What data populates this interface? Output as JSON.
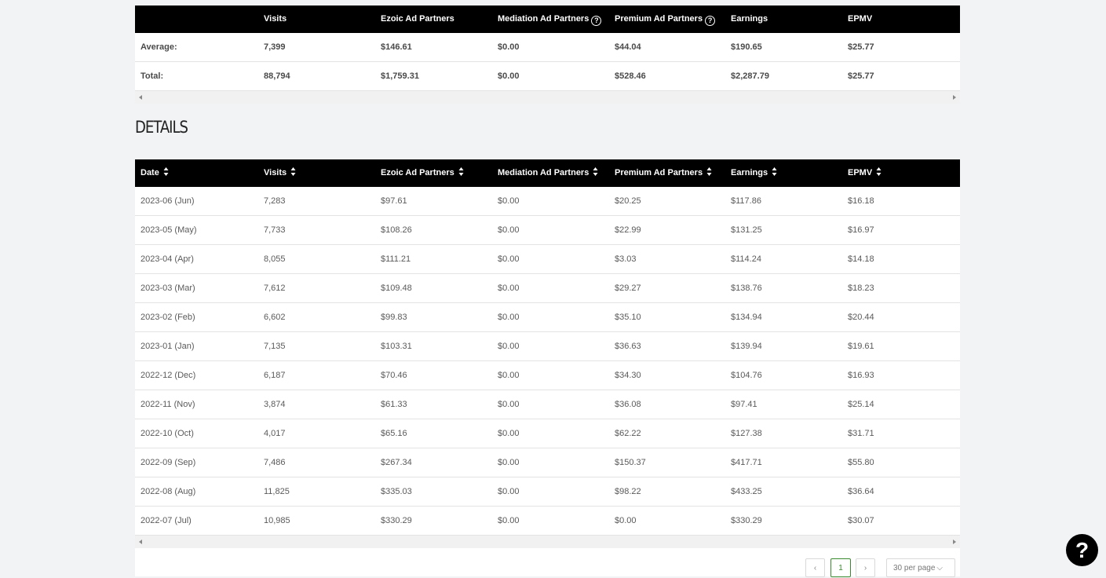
{
  "summary": {
    "columns": [
      "",
      "Visits",
      "Ezoic Ad Partners",
      "Mediation Ad Partners",
      "Premium Ad Partners",
      "Earnings",
      "EPMV"
    ],
    "rows": [
      [
        "Average:",
        "7,399",
        "$146.61",
        "$0.00",
        "$44.04",
        "$190.65",
        "$25.77"
      ],
      [
        "Total:",
        "88,794",
        "$1,759.31",
        "$0.00",
        "$528.46",
        "$2,287.79",
        "$25.77"
      ]
    ],
    "help_icon": "question-circle-icon"
  },
  "details": {
    "title": "DETAILS",
    "columns": [
      "Date",
      "Visits",
      "Ezoic Ad Partners",
      "Mediation Ad Partners",
      "Premium Ad Partners",
      "Earnings",
      "EPMV"
    ],
    "rows": [
      [
        "2023-06 (Jun)",
        "7,283",
        "$97.61",
        "$0.00",
        "$20.25",
        "$117.86",
        "$16.18"
      ],
      [
        "2023-05 (May)",
        "7,733",
        "$108.26",
        "$0.00",
        "$22.99",
        "$131.25",
        "$16.97"
      ],
      [
        "2023-04 (Apr)",
        "8,055",
        "$111.21",
        "$0.00",
        "$3.03",
        "$114.24",
        "$14.18"
      ],
      [
        "2023-03 (Mar)",
        "7,612",
        "$109.48",
        "$0.00",
        "$29.27",
        "$138.76",
        "$18.23"
      ],
      [
        "2023-02 (Feb)",
        "6,602",
        "$99.83",
        "$0.00",
        "$35.10",
        "$134.94",
        "$20.44"
      ],
      [
        "2023-01 (Jan)",
        "7,135",
        "$103.31",
        "$0.00",
        "$36.63",
        "$139.94",
        "$19.61"
      ],
      [
        "2022-12 (Dec)",
        "6,187",
        "$70.46",
        "$0.00",
        "$34.30",
        "$104.76",
        "$16.93"
      ],
      [
        "2022-11 (Nov)",
        "3,874",
        "$61.33",
        "$0.00",
        "$36.08",
        "$97.41",
        "$25.14"
      ],
      [
        "2022-10 (Oct)",
        "4,017",
        "$65.16",
        "$0.00",
        "$62.22",
        "$127.38",
        "$31.71"
      ],
      [
        "2022-09 (Sep)",
        "7,486",
        "$267.34",
        "$0.00",
        "$150.37",
        "$417.71",
        "$55.80"
      ],
      [
        "2022-08 (Aug)",
        "11,825",
        "$335.03",
        "$0.00",
        "$98.22",
        "$433.25",
        "$36.64"
      ],
      [
        "2022-07 (Jul)",
        "10,985",
        "$330.29",
        "$0.00",
        "$0.00",
        "$330.29",
        "$30.07"
      ]
    ]
  },
  "pagination": {
    "prev": "‹",
    "current_page": "1",
    "next": "›",
    "page_size": "30 per page"
  },
  "help_button": "?",
  "colors": {
    "header_bg": "#000000",
    "page_bg": "#f2f3f5",
    "active_page": "#3a8a2f"
  }
}
